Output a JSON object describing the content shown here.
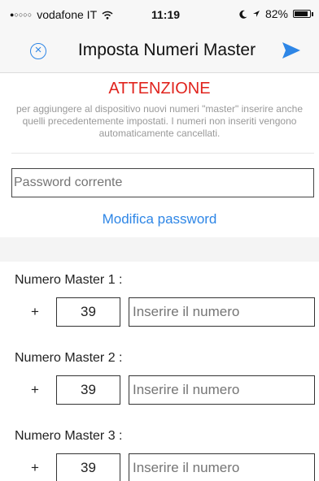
{
  "status_bar": {
    "signal": "●○○○○",
    "carrier": "vodafone IT",
    "wifi": "wifi-icon",
    "time": "11:19",
    "battery": "82%"
  },
  "navbar": {
    "title": "Imposta Numeri Master",
    "close_icon": "close-circle-icon",
    "send_icon": "send-icon",
    "accent": "#2e86e6"
  },
  "warning": {
    "title": "ATTENZIONE",
    "text": "per aggiungere al dispositivo nuovi numeri \"master\" inserire anche quelli precedentemente impostati. I numeri non inseriti vengono automaticamente cancellati.",
    "color": "#e0231d"
  },
  "password": {
    "placeholder": "Password corrente",
    "change_link": "Modifica password"
  },
  "masters": [
    {
      "label": "Numero Master 1 :",
      "plus": "+",
      "prefix": "39",
      "placeholder": "Inserire il numero"
    },
    {
      "label": "Numero Master 2 :",
      "plus": "+",
      "prefix": "39",
      "placeholder": "Inserire il numero"
    },
    {
      "label": "Numero Master 3 :",
      "plus": "+",
      "prefix": "39",
      "placeholder": "Inserire il numero"
    }
  ]
}
